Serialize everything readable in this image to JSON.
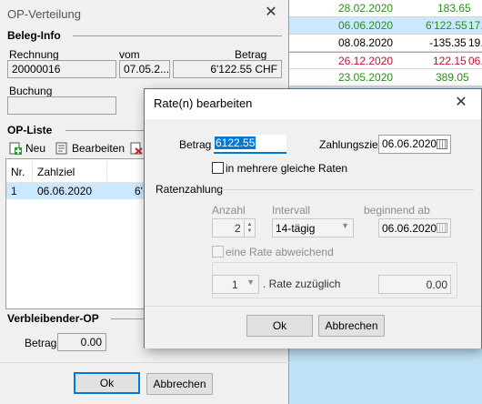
{
  "background_grid": {
    "rows": [
      {
        "date": "28.02.2020",
        "amount": "183.65",
        "extra": ""
      },
      {
        "date": "06.06.2020",
        "amount": "6'122.55",
        "extra": "17."
      },
      {
        "date": "08.08.2020",
        "amount": "-135.35",
        "extra": "19."
      },
      {
        "date": "26.12.2020",
        "amount": "122.15",
        "extra": "06."
      },
      {
        "date": "23.05.2020",
        "amount": "389.05",
        "extra": ""
      }
    ]
  },
  "op_window": {
    "title": "OP-Verteilung",
    "beleg_info": {
      "section_title": "Beleg-Info",
      "rechnung_label": "Rechnung",
      "vom_label": "vom",
      "betrag_label": "Betrag",
      "rechnung_value": "20000016",
      "vom_value": "07.05.2...",
      "betrag_value": "6'122.55 CHF",
      "buchung_label": "Buchung",
      "buchung_value": ""
    },
    "op_liste": {
      "section_title": "OP-Liste",
      "toolbar": {
        "neu": "Neu",
        "bearbeiten": "Bearbeiten"
      },
      "columns": [
        "Nr.",
        "Zahlziel",
        ""
      ],
      "rows": [
        {
          "nr": "1",
          "zahlziel": "06.06.2020",
          "betrag": "6'"
        }
      ]
    },
    "verbleibender": {
      "section_title": "Verbleibender-OP",
      "betrag_label": "Betrag",
      "betrag_value": "0.00"
    },
    "ok_label": "Ok",
    "cancel_label": "Abbrechen"
  },
  "rate_dialog": {
    "title": "Rate(n) bearbeiten",
    "betrag_label": "Betrag",
    "betrag_value": "6122.55",
    "zahlungsziel_label": "Zahlungsziel",
    "zahlungsziel_value": "06.06.2020",
    "gleiche_raten_label": "in mehrere gleiche Raten",
    "ratenzahlung_title": "Ratenzahlung",
    "anzahl_label": "Anzahl",
    "anzahl_value": "2",
    "intervall_label": "Intervall",
    "intervall_value": "14-tägig",
    "beginnend_label": "beginnend ab",
    "beginnend_value": "06.06.2020",
    "abweichend_label": "eine Rate abweichend",
    "rate_select_value": "1",
    "rate_zuzueglich_label": ". Rate zuzüglich",
    "rate_amount_value": "0.00",
    "ok_label": "Ok",
    "cancel_label": "Abbrechen"
  },
  "colors": {
    "selection": "#cce8ff",
    "green_text": "#2e8b1e",
    "red_text": "#c0102e",
    "accent": "#0078d7"
  }
}
